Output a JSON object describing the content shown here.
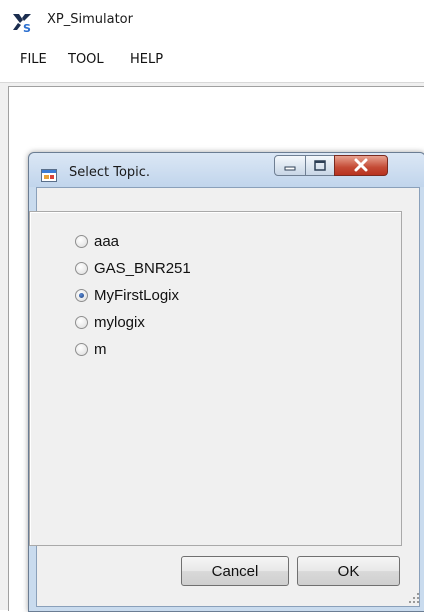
{
  "app": {
    "title": "XP_Simulator",
    "logo_icon": "xs-logo-icon"
  },
  "menu": {
    "items": [
      {
        "label": "FILE"
      },
      {
        "label": "TOOL"
      },
      {
        "label": "HELP"
      }
    ]
  },
  "dialog": {
    "title": "Select Topic.",
    "icon": "form-window-icon",
    "window_buttons": {
      "minimize_icon": "minimize-icon",
      "maximize_icon": "maximize-icon",
      "close_icon": "close-icon"
    },
    "topics": [
      {
        "label": "aaa",
        "checked": false
      },
      {
        "label": "GAS_BNR251",
        "checked": false
      },
      {
        "label": "MyFirstLogix",
        "checked": true
      },
      {
        "label": "mylogix",
        "checked": false
      },
      {
        "label": "m",
        "checked": false
      }
    ],
    "cancel_label": "Cancel",
    "ok_label": "OK"
  },
  "colors": {
    "close_button": "#c44a35",
    "dialog_frame": "#c9dbee",
    "radio_selected": "#1e3f7a"
  }
}
